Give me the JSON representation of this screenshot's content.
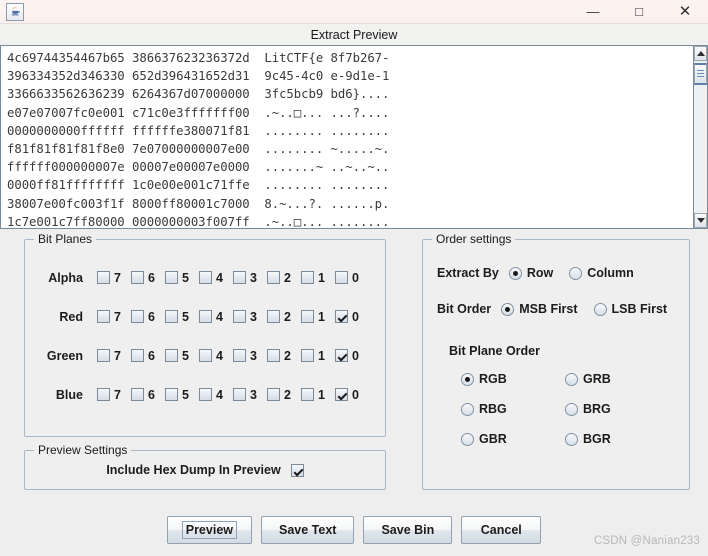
{
  "window": {
    "app_icon": "java-coffee-cup-icon",
    "title": "Extract Preview",
    "controls": {
      "minimize": "—",
      "maximize": "□",
      "close": "✕"
    }
  },
  "preview": {
    "hex_lines": [
      "4c69744354467b65 386637623236372d  LitCTF{e 8f7b267-",
      "396334352d346330 652d396431652d31  9c45-4c0 e-9d1e-1",
      "3366633562636239 6264367d07000000  3fc5bcb9 bd6}....",
      "e07e07007fc0e001 c71c0e3fffffff00  .~..□... ...?....",
      "0000000000ffffff ffffffe380071f81  ........ ........",
      "f81f81f81f81f8e0 7e07000000007e00  ........ ~.....~.",
      "ffffff000000007e 00007e00007e0000  .......~ ..~..~..",
      "0000ff81ffffffff 1c0e00e001c71ffe  ........ ........",
      "38007e00fc003f1f 8000ff80001c7000  8.~...?. ......p.",
      "1c7e001c7ff80000 0000000003f007ff  .~..□... ........"
    ],
    "scrollbar": {
      "up_arrow": "scroll-up-arrow-icon",
      "down_arrow": "scroll-down-arrow-icon"
    }
  },
  "bit_planes": {
    "legend": "Bit Planes",
    "bit_labels": [
      "7",
      "6",
      "5",
      "4",
      "3",
      "2",
      "1",
      "0"
    ],
    "rows": [
      {
        "label": "Alpha",
        "checked": [
          false,
          false,
          false,
          false,
          false,
          false,
          false,
          false
        ]
      },
      {
        "label": "Red",
        "checked": [
          false,
          false,
          false,
          false,
          false,
          false,
          false,
          true
        ]
      },
      {
        "label": "Green",
        "checked": [
          false,
          false,
          false,
          false,
          false,
          false,
          false,
          true
        ]
      },
      {
        "label": "Blue",
        "checked": [
          false,
          false,
          false,
          false,
          false,
          false,
          false,
          true
        ]
      }
    ]
  },
  "preview_settings": {
    "legend": "Preview Settings",
    "include_hex_dump_label": "Include Hex Dump In Preview",
    "include_hex_dump_checked": true
  },
  "order_settings": {
    "legend": "Order settings",
    "extract_by": {
      "label": "Extract By",
      "options": [
        "Row",
        "Column"
      ],
      "selected": "Row"
    },
    "bit_order": {
      "label": "Bit Order",
      "options": [
        "MSB First",
        "LSB First"
      ],
      "selected": "MSB First"
    },
    "bit_plane_order": {
      "label": "Bit Plane Order",
      "options": [
        "RGB",
        "GRB",
        "RBG",
        "BRG",
        "GBR",
        "BGR"
      ],
      "selected": "RGB"
    }
  },
  "buttons": [
    {
      "label": "Preview",
      "focused": true
    },
    {
      "label": "Save Text",
      "focused": false
    },
    {
      "label": "Save Bin",
      "focused": false
    },
    {
      "label": "Cancel",
      "focused": false
    }
  ],
  "watermark": "CSDN @Nanian233",
  "colors": {
    "panel_bg": "#efefef",
    "panel_border": "#a9b7c6",
    "titlebar_bg": "#fdf4f2",
    "subtitle_bg": "#f1f1f0",
    "text_area_bg": "#ffffff",
    "hex_text": "#3a3a3a",
    "watermark": "#b8b8b8"
  }
}
